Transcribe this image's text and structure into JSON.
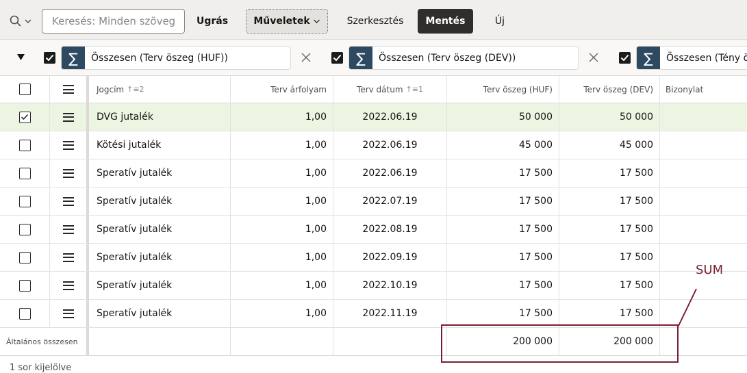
{
  "toolbar": {
    "search_placeholder": "Keresés: Minden szöveges oszlop",
    "goto_label": "Ugrás",
    "actions_label": "Műveletek",
    "edit_label": "Szerkesztés",
    "save_label": "Mentés",
    "new_label": "Új"
  },
  "aggregates": [
    {
      "label": "Összesen (Terv öszeg (HUF))",
      "checked": true
    },
    {
      "label": "Összesen (Terv öszeg (DEV))",
      "checked": true
    },
    {
      "label": "Összesen (Tény öss",
      "checked": true
    }
  ],
  "columns": {
    "jogcim": "Jogcím",
    "jogcim_sort": "↑≡2",
    "arfolyam": "Terv árfolyam",
    "datum": "Terv dátum",
    "datum_sort": "↑≡1",
    "huf": "Terv öszeg (HUF)",
    "dev": "Terv öszeg (DEV)",
    "bizonylat": "Bizonylat"
  },
  "rows": [
    {
      "checked": true,
      "jogcim": "DVG jutalék",
      "arfolyam": "1,00",
      "datum": "2022.06.19",
      "huf": "50 000",
      "dev": "50 000"
    },
    {
      "checked": false,
      "jogcim": "Kötési jutalék",
      "arfolyam": "1,00",
      "datum": "2022.06.19",
      "huf": "45 000",
      "dev": "45 000"
    },
    {
      "checked": false,
      "jogcim": "Speratív jutalék",
      "arfolyam": "1,00",
      "datum": "2022.06.19",
      "huf": "17 500",
      "dev": "17 500"
    },
    {
      "checked": false,
      "jogcim": "Speratív jutalék",
      "arfolyam": "1,00",
      "datum": "2022.07.19",
      "huf": "17 500",
      "dev": "17 500"
    },
    {
      "checked": false,
      "jogcim": "Speratív jutalék",
      "arfolyam": "1,00",
      "datum": "2022.08.19",
      "huf": "17 500",
      "dev": "17 500"
    },
    {
      "checked": false,
      "jogcim": "Speratív jutalék",
      "arfolyam": "1,00",
      "datum": "2022.09.19",
      "huf": "17 500",
      "dev": "17 500"
    },
    {
      "checked": false,
      "jogcim": "Speratív jutalék",
      "arfolyam": "1,00",
      "datum": "2022.10.19",
      "huf": "17 500",
      "dev": "17 500"
    },
    {
      "checked": false,
      "jogcim": "Speratív jutalék",
      "arfolyam": "1,00",
      "datum": "2022.11.19",
      "huf": "17 500",
      "dev": "17 500"
    }
  ],
  "totals": {
    "label": "Általános összesen",
    "huf": "200 000",
    "dev": "200 000"
  },
  "status": "1 sor kijelölve",
  "annotation": {
    "text": "SUM",
    "color": "#7a1f33"
  },
  "colors": {
    "save_bg": "#312d2a",
    "sigma_bg": "#2e4a63",
    "selected_row": "#ecf4e2"
  }
}
